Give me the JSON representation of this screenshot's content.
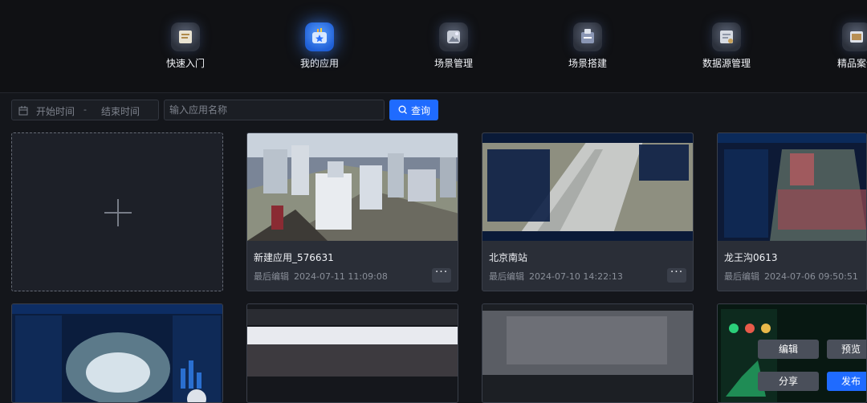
{
  "nav": {
    "items": [
      {
        "label": "快速入门",
        "icon": "quick-start-icon"
      },
      {
        "label": "我的应用",
        "icon": "my-apps-icon",
        "active": true
      },
      {
        "label": "场景管理",
        "icon": "scene-management-icon"
      },
      {
        "label": "场景搭建",
        "icon": "scene-building-icon"
      },
      {
        "label": "数据源管理",
        "icon": "datasource-management-icon"
      },
      {
        "label": "精品案例",
        "icon": "showcase-icon"
      }
    ]
  },
  "filters": {
    "start_placeholder": "开始时间",
    "separator": "-",
    "end_placeholder": "结束时间",
    "search_placeholder": "输入应用名称",
    "query_label": "查询"
  },
  "meta_label": "最后编辑",
  "apps": [
    {
      "name": "新建应用_576631",
      "edited": "2024-07-11 11:09:08"
    },
    {
      "name": "北京南站",
      "edited": "2024-07-10 14:22:13"
    },
    {
      "name": "龙王沟0613",
      "edited": "2024-07-06 09:50:51"
    }
  ],
  "more_label": "···",
  "hover_actions": {
    "edit": "编辑",
    "preview": "预览",
    "share": "分享",
    "publish": "发布"
  },
  "colors": {
    "accent": "#1f6bff",
    "background": "#14161b",
    "card": "#2a2e37"
  }
}
